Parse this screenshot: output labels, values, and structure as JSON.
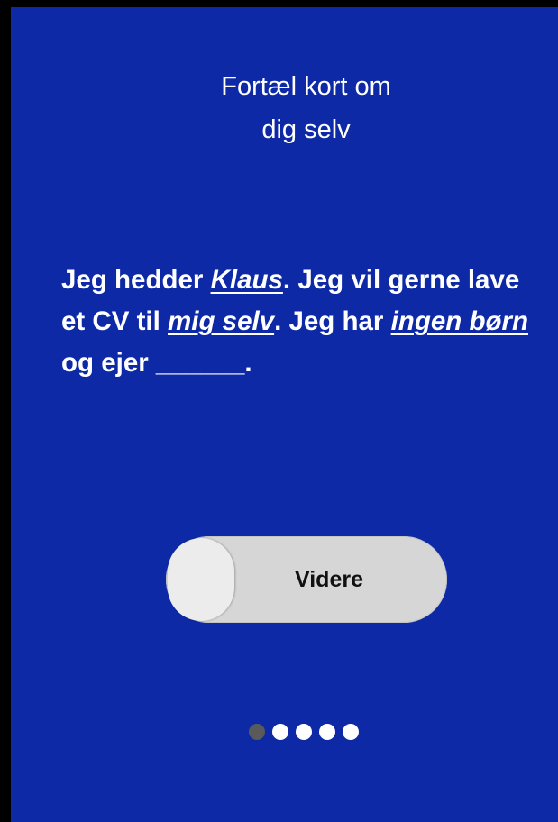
{
  "title": {
    "line1": "Fortæl kort om",
    "line2": "dig selv"
  },
  "sentence": {
    "part1": "Jeg hedder ",
    "name": "Klaus",
    "part2": ". Jeg vil gerne lave et CV til ",
    "for_whom": "mig selv",
    "part3": ".  Jeg har ",
    "children": "ingen børn",
    "part4": " og ejer ______."
  },
  "slider": {
    "label": "Videre"
  },
  "pagination": {
    "total": 5,
    "current": 1
  },
  "colors": {
    "background": "#0d29a6",
    "text": "#ffffff",
    "slider_track": "#d6d6d6",
    "slider_knob": "#ececec",
    "dot_active": "#5a5a5a",
    "dot_inactive": "#ffffff"
  }
}
